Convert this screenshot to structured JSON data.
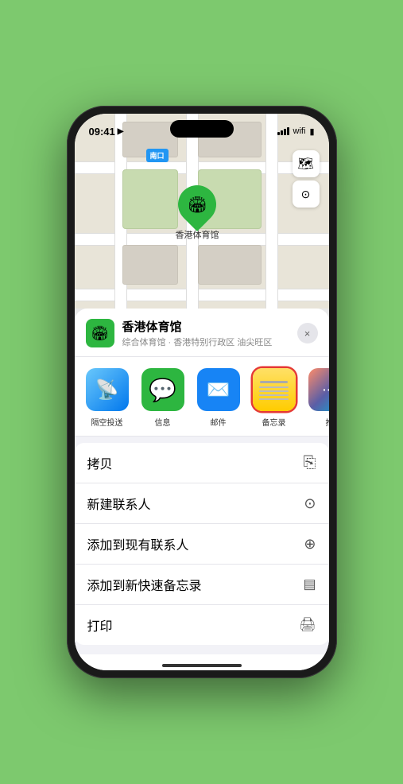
{
  "status_bar": {
    "time": "09:41",
    "location_arrow": "▶"
  },
  "map": {
    "exit_label": "南口",
    "venue_pin_label": "香港体育馆"
  },
  "venue_card": {
    "name": "香港体育馆",
    "description": "综合体育馆 · 香港特别行政区 油尖旺区",
    "close_label": "×"
  },
  "share_apps": [
    {
      "id": "airdrop",
      "label": "隔空投送",
      "icon": "📡"
    },
    {
      "id": "messages",
      "label": "信息",
      "icon": "💬"
    },
    {
      "id": "mail",
      "label": "邮件",
      "icon": "✉"
    },
    {
      "id": "notes",
      "label": "备忘录",
      "icon": ""
    },
    {
      "id": "more",
      "label": "推",
      "icon": "···"
    }
  ],
  "action_items": [
    {
      "label": "拷贝",
      "icon": "⎘"
    },
    {
      "label": "新建联系人",
      "icon": "👤"
    },
    {
      "label": "添加到现有联系人",
      "icon": "👤+"
    },
    {
      "label": "添加到新快速备忘录",
      "icon": "📋"
    },
    {
      "label": "打印",
      "icon": "🖨"
    }
  ],
  "colors": {
    "accent_green": "#2db640",
    "highlight_red": "#e53935",
    "map_bg": "#e8e4d8"
  }
}
